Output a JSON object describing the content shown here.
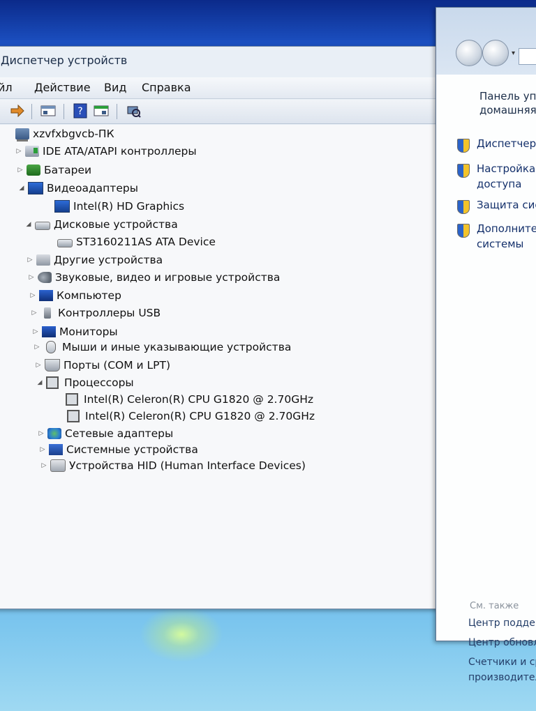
{
  "device_manager": {
    "title": "Диспетчер устройств",
    "menu": [
      "йл",
      "Действие",
      "Вид",
      "Справка"
    ],
    "tree": [
      {
        "label": "xzvfxbgvcb-ПК",
        "expander": "",
        "icon": "computer-icon"
      },
      {
        "label": "IDE ATA/ATAPI контроллеры",
        "expander": "▷",
        "icon": "ide-controller-icon"
      },
      {
        "label": "Батареи",
        "expander": "▷",
        "icon": "battery-icon"
      },
      {
        "label": "Видеоадаптеры",
        "expander": "◢",
        "icon": "display-adapter-icon"
      },
      {
        "label": "Intel(R) HD Graphics",
        "expander": "",
        "icon": "display-adapter-icon"
      },
      {
        "label": "Дисковые устройства",
        "expander": "◢",
        "icon": "disk-drive-icon"
      },
      {
        "label": "ST3160211AS ATA Device",
        "expander": "",
        "icon": "disk-drive-icon"
      },
      {
        "label": "Другие устройства",
        "expander": "▷",
        "icon": "other-devices-icon"
      },
      {
        "label": "Звуковые, видео и игровые устройства",
        "expander": "▷",
        "icon": "sound-icon"
      },
      {
        "label": "Компьютер",
        "expander": "▷",
        "icon": "pc-icon"
      },
      {
        "label": "Контроллеры USB",
        "expander": "▷",
        "icon": "usb-icon"
      },
      {
        "label": "Мониторы",
        "expander": "▷",
        "icon": "monitor-icon"
      },
      {
        "label": "Мыши и иные указывающие устройства",
        "expander": "▷",
        "icon": "mouse-icon"
      },
      {
        "label": "Порты (COM и LPT)",
        "expander": "▷",
        "icon": "port-icon"
      },
      {
        "label": "Процессоры",
        "expander": "◢",
        "icon": "processor-icon"
      },
      {
        "label": "Intel(R) Celeron(R) CPU G1820 @ 2.70GHz",
        "expander": "",
        "icon": "processor-icon"
      },
      {
        "label": "Intel(R) Celeron(R) CPU G1820 @ 2.70GHz",
        "expander": "",
        "icon": "processor-icon"
      },
      {
        "label": "Сетевые адаптеры",
        "expander": "▷",
        "icon": "network-adapter-icon"
      },
      {
        "label": "Системные устройства",
        "expander": "▷",
        "icon": "system-devices-icon"
      },
      {
        "label": "Устройства HID (Human Interface Devices)",
        "expander": "▷",
        "icon": "hid-icon"
      }
    ]
  },
  "control_panel": {
    "header_line1": "Панель упр",
    "header_line2": "домашняя",
    "tasks": [
      {
        "line1": "Диспетчер",
        "line2": ""
      },
      {
        "line1": "Настройка",
        "line2": "доступа"
      },
      {
        "line1": "Защита сис",
        "line2": ""
      },
      {
        "line1": "Дополнител",
        "line2": "системы"
      }
    ],
    "see_also": "См. также",
    "links": [
      {
        "line1": "Центр поддер",
        "line2": ""
      },
      {
        "line1": "Центр обновл",
        "line2": ""
      },
      {
        "line1": "Счетчики и ср",
        "line2": "производител"
      }
    ]
  }
}
